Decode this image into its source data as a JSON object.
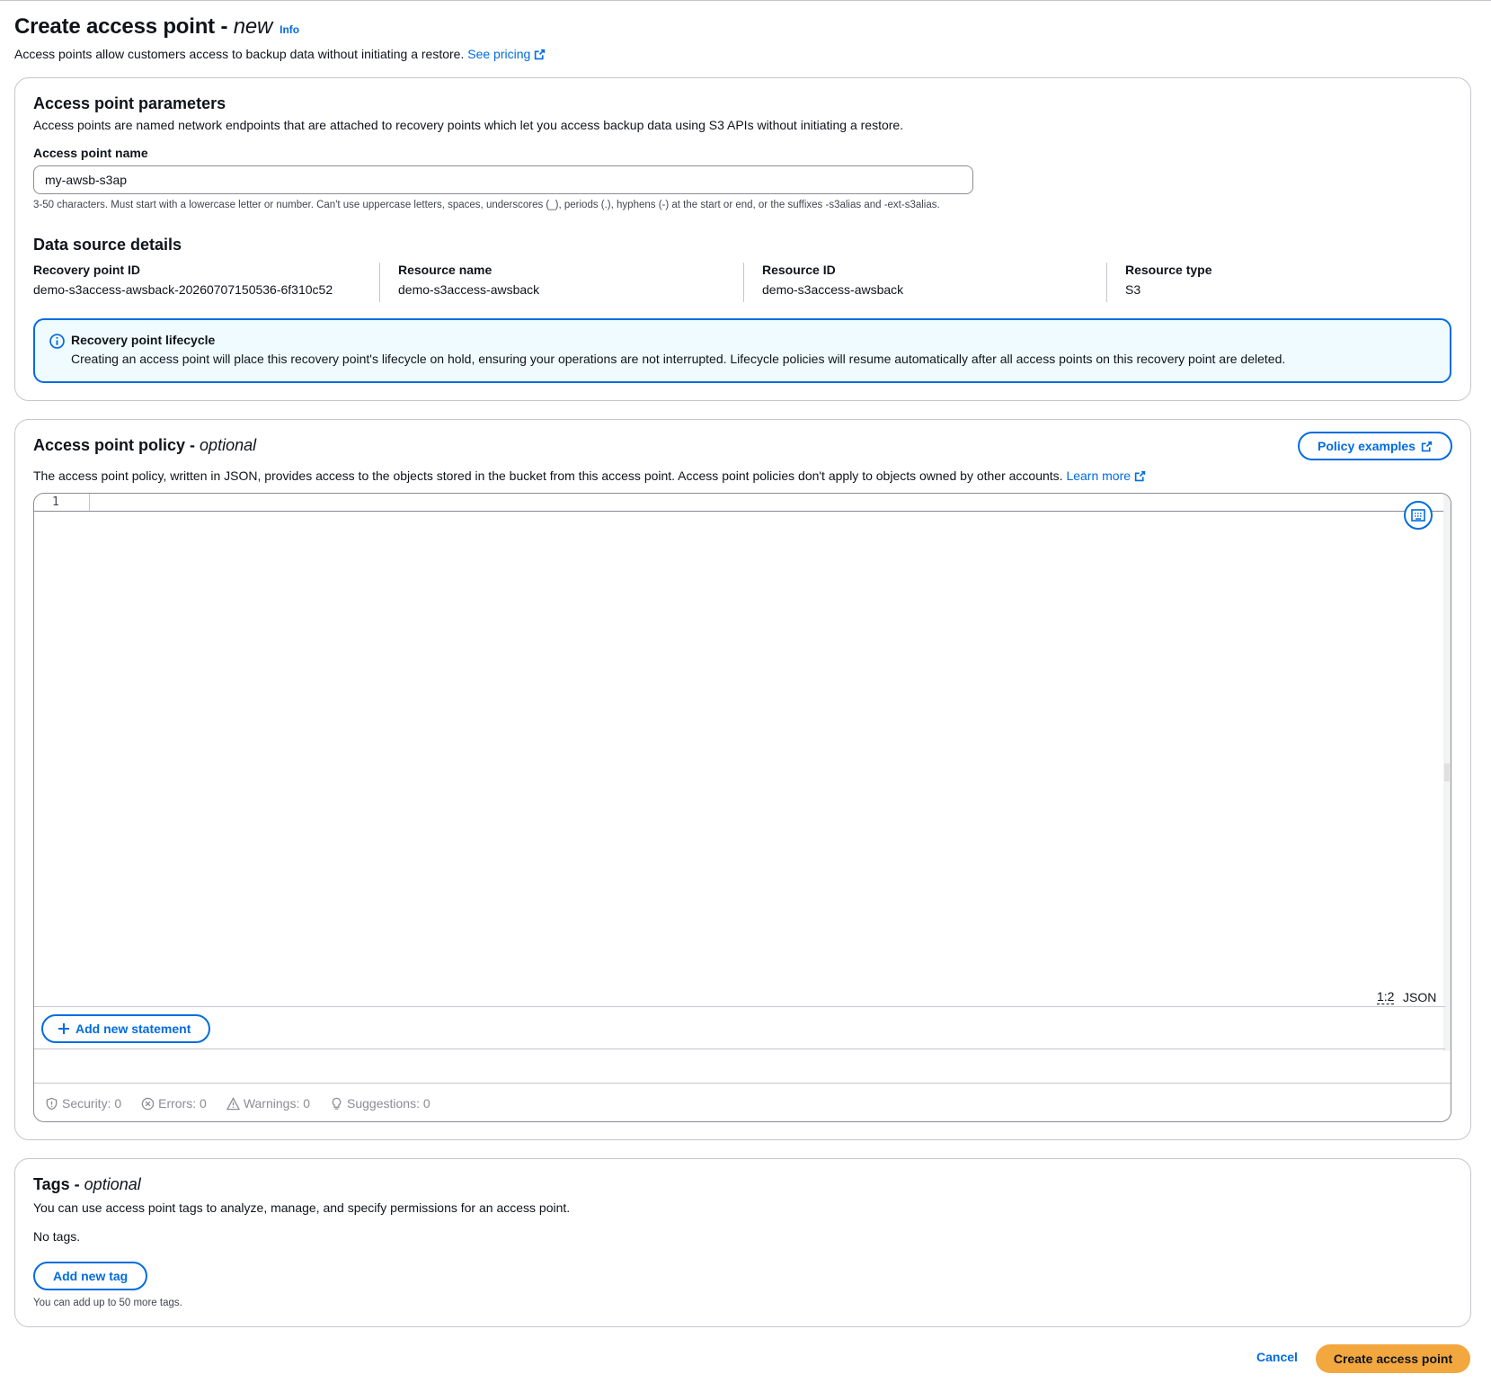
{
  "header": {
    "title": "Create access point - ",
    "title_suffix": "new",
    "info_label": "Info",
    "description": "Access points allow customers access to backup data without initiating a restore.",
    "pricing_link": "See pricing"
  },
  "parameters": {
    "title": "Access point parameters",
    "description": "Access points are named network endpoints that are attached to recovery points which let you access backup data using S3 APIs without initiating a restore.",
    "name_label": "Access point name",
    "name_value": "my-awsb-s3ap",
    "name_constraint": "3-50 characters. Must start with a lowercase letter or number. Can't use uppercase letters, spaces, underscores (_), periods (.), hyphens (-) at the start or end, or the suffixes -s3alias and -ext-s3alias.",
    "data_source_title": "Data source details",
    "details": [
      {
        "key": "Recovery point ID",
        "value": "demo-s3access-awsback-20260707150536-6f310c52"
      },
      {
        "key": "Resource name",
        "value": "demo-s3access-awsback"
      },
      {
        "key": "Resource ID",
        "value": "demo-s3access-awsback"
      },
      {
        "key": "Resource type",
        "value": "S3"
      }
    ],
    "alert": {
      "title": "Recovery point lifecycle",
      "body": "Creating an access point will place this recovery point's lifecycle on hold, ensuring your operations are not interrupted. Lifecycle policies will resume automatically after all access points on this recovery point are deleted."
    }
  },
  "policy": {
    "title": "Access point policy - ",
    "title_suffix": "optional",
    "examples_button": "Policy examples",
    "description": "The access point policy, written in JSON, provides access to the objects stored in the bucket from this access point. Access point policies don't apply to objects owned by other accounts.",
    "learn_more": "Learn more",
    "editor": {
      "line_number": "1",
      "cursor_position": "1:2",
      "language": "JSON",
      "add_statement_button": "Add new statement",
      "status": {
        "security": "Security: 0",
        "errors": "Errors: 0",
        "warnings": "Warnings: 0",
        "suggestions": "Suggestions: 0"
      }
    }
  },
  "tags": {
    "title": "Tags - ",
    "title_suffix": "optional",
    "description": "You can use access point tags to analyze, manage, and specify permissions for an access point.",
    "empty_text": "No tags.",
    "add_button": "Add new tag",
    "limit_text": "You can add up to 50 more tags."
  },
  "footer": {
    "cancel": "Cancel",
    "submit": "Create access point"
  },
  "colors": {
    "link": "#006ce0",
    "primary_button": "#f3a73f",
    "alert_background": "#f0fbff",
    "border": "#c6c6cd"
  }
}
